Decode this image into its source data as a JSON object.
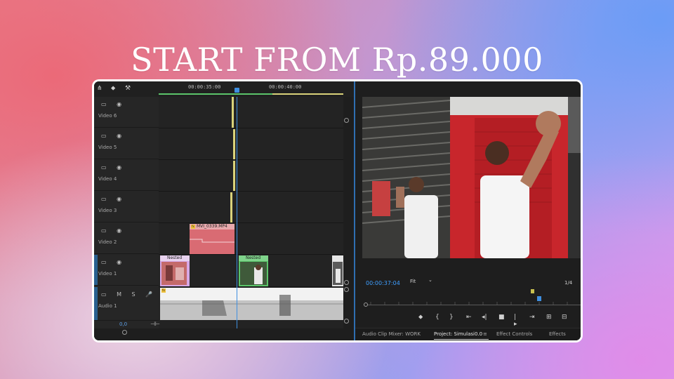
{
  "headline": "START FROM Rp.89.000",
  "timeline": {
    "toolbar_icons": [
      "magnet-icon",
      "marker-icon",
      "wrench-icon"
    ],
    "ruler_times": [
      "00:00:35:00",
      "00:00:40:00"
    ],
    "tracks": [
      {
        "name": "Video 6",
        "icons": "▭ ◉"
      },
      {
        "name": "Video 5",
        "icons": "▭ ◉"
      },
      {
        "name": "Video 4",
        "icons": "▭ ◉"
      },
      {
        "name": "Video 3",
        "icons": "▭ ◉"
      },
      {
        "name": "Video 2",
        "icons": "▭ ◉"
      },
      {
        "name": "Video 1",
        "icons": "▭ ◉"
      },
      {
        "name": "Audio 1",
        "icons": "▭ M S 🎤"
      }
    ],
    "clips": {
      "video2_clip": "MVI_0339.MP4",
      "nested_a": "Nested",
      "nested_b": "Nested",
      "fx_badge": "fx"
    },
    "bottom_value": "0,0",
    "end_icon": "⊣⊢"
  },
  "monitor": {
    "timecode": "00:00:37:04",
    "fit": "Fit",
    "fit_arrow": "⌄",
    "fraction": "1/4",
    "transport_icons": [
      "marker-icon",
      "mark-in-icon",
      "mark-out-icon",
      "go-to-in-icon",
      "step-back-icon",
      "stop-icon",
      "step-forward-icon",
      "go-to-out-icon",
      "insert-icon",
      "overwrite-icon"
    ],
    "transport_glyphs": [
      "⬥",
      "{",
      "}",
      "⇤",
      "◂|",
      "■",
      "|▸",
      "⇥",
      "⊞",
      "⊟"
    ],
    "tabs": [
      "Audio Clip Mixer: WORK",
      "Project: Simulasi0.0",
      "≡",
      "Effect Controls",
      "Effects"
    ]
  },
  "colors": {
    "accent_blue": "#3f8fe0",
    "timecode_blue": "#3f9fff",
    "clip_red": "#d96b73",
    "clip_green": "#5bc46a",
    "clip_yellow": "#d9d27a",
    "fx_yellow": "#f0c23c"
  }
}
